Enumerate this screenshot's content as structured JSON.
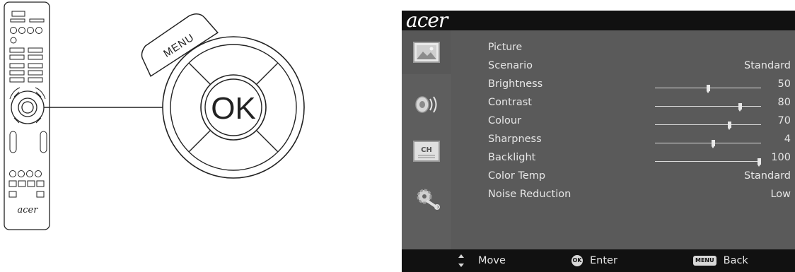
{
  "remote": {
    "brand": "acer",
    "menu_label": "MENU",
    "ok_label": "OK"
  },
  "osd": {
    "logo": "acer",
    "sidebar": [
      {
        "icon": "picture-icon",
        "active": true
      },
      {
        "icon": "sound-icon",
        "active": false
      },
      {
        "icon": "channel-icon",
        "label": "CH",
        "active": false
      },
      {
        "icon": "settings-icon",
        "active": false
      }
    ],
    "title": "Picture",
    "rows": [
      {
        "label": "Scenario",
        "value": "Standard"
      },
      {
        "label": "Brightness",
        "value": "50",
        "slider": 50
      },
      {
        "label": "Contrast",
        "value": "80",
        "slider": 80
      },
      {
        "label": "Colour",
        "value": "70",
        "slider": 70
      },
      {
        "label": "Sharpness",
        "value": "4",
        "slider": 55
      },
      {
        "label": "Backlight",
        "value": "100",
        "slider": 100
      },
      {
        "label": "Color Temp",
        "value": "Standard"
      },
      {
        "label": "Noise Reduction",
        "value": "Low"
      }
    ],
    "bottom": {
      "move": "Move",
      "ok_badge": "OK",
      "enter": "Enter",
      "menu_badge": "MENU",
      "back": "Back"
    }
  }
}
